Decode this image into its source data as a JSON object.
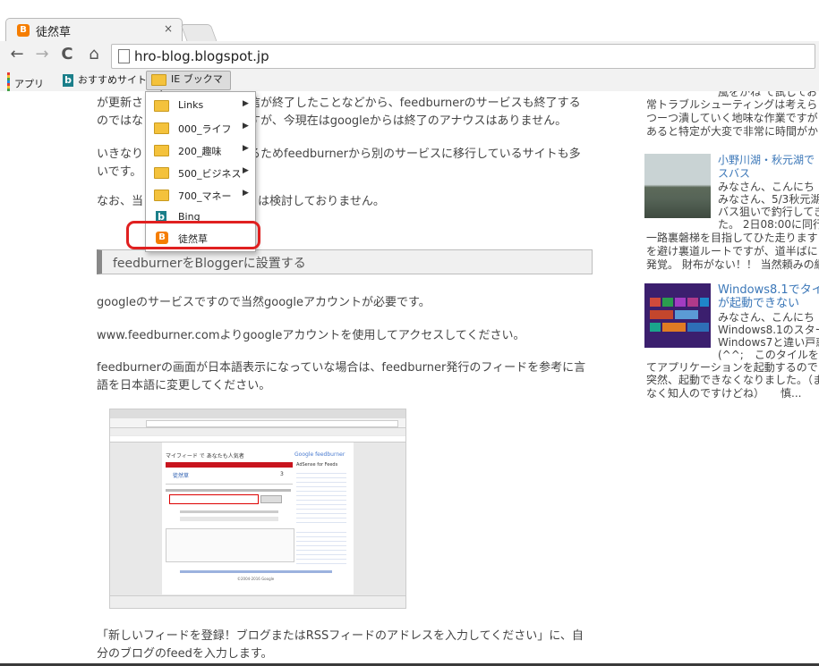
{
  "tab": {
    "title": "徒然草",
    "close": "×"
  },
  "toolbar": {
    "back": "←",
    "forward": "→",
    "reload": "C",
    "home": "⌂",
    "url": "hro-blog.blogspot.jp"
  },
  "bookmarks": [
    {
      "label": "アプリ",
      "icon": "apps-icon"
    },
    {
      "label": "おすすめサイト",
      "icon": "bing-icon"
    },
    {
      "label": "IE ブックマーク",
      "icon": "folder-icon"
    }
  ],
  "menu": [
    {
      "label": "Links",
      "submenu": true
    },
    {
      "label": "000_ライフ",
      "submenu": true
    },
    {
      "label": "200_趣味",
      "submenu": true
    },
    {
      "label": "500_ビジネス",
      "submenu": true
    },
    {
      "label": "700_マネー",
      "submenu": true
    },
    {
      "label": "Bing",
      "submenu": false
    },
    {
      "label": "徒然草",
      "submenu": false
    }
  ],
  "article": {
    "p1_line1": "が更新さ",
    "p1_line1b": "信が終了したことなどから、feedburnerのサービスも終了する",
    "p1_line2": "のではな",
    "p1_line2b": "すが、今現在はgoogleからは終了のアナウスはありません。",
    "p2_line1": "いきなり",
    "p2_line1b": "るためfeedburnerから別のサービスに移行しているサイトも多",
    "p2_line2": "いです。",
    "p3": "なお、当",
    "p3b": "は検討しておりません。",
    "section_title": "feedburnerをBloggerに設置する",
    "p4": "googleのサービスですので当然googleアカウントが必要です。",
    "p5": "www.feedburner.comよりgoogleアカウントを使用してアクセスしてください。",
    "p6_line1": "feedburnerの画面が日本語表示になっていな場合は、feedburner発行のフィードを参考に言",
    "p6_line2": "語を日本語に変更してください。",
    "p7_line1": "「新しいフィードを登録！ブログまたはRSSフィードのアドレスを入力してください」に、自",
    "p7_line2": "分のブログのfeedを入力します。"
  },
  "screenshot": {
    "heading": "マイフィード で あなたも人気者",
    "brand": "Google feedburner",
    "feed_name": "徒然草",
    "count": "3",
    "sidebar_title": "AdSense for Feeds",
    "footer": "©2004-2016 Google"
  },
  "sidebar": {
    "top1": "風をかね て試しておさ",
    "top2": "常トラブルシューティングは考えら",
    "top3": "つーつ潰していく地味な作業ですが",
    "top4": "あると特定が大変で非常に時間がか",
    "post1_title_1": "小野川湖・秋元湖で",
    "post1_title_2": "スバス",
    "post1_lines": [
      "みなさん、こんにち",
      "みなさん、5/3秋元湖にスモ",
      "バス狙いで釣行してき",
      "た。 2日08:00に同行"
    ],
    "post1_lines_wide": [
      "一路裏磐梯を目指してひた走ります",
      "を避け裏道ルートですが、道半ばに",
      "発覚。 財布がない！！ 当然頼みの綱"
    ],
    "post2_title_1": "Windows8.1でタイル",
    "post2_title_2": "が起動できない",
    "post2_lines": [
      "みなさん、こんにち",
      "Windows8.1のスター",
      "Windows7と違い戸惑",
      "(^^;　このタイルを"
    ],
    "post2_lines_wide": [
      "てアプリケーションを起動するので",
      "突然、起動できなくなりました。（ま",
      "なく知人のですけどね）　　慎..."
    ]
  },
  "colors": {
    "highlight": "#e02020",
    "accent_link": "#3b77b8",
    "folder": "#f4c23c",
    "blogger": "#f57d00"
  }
}
